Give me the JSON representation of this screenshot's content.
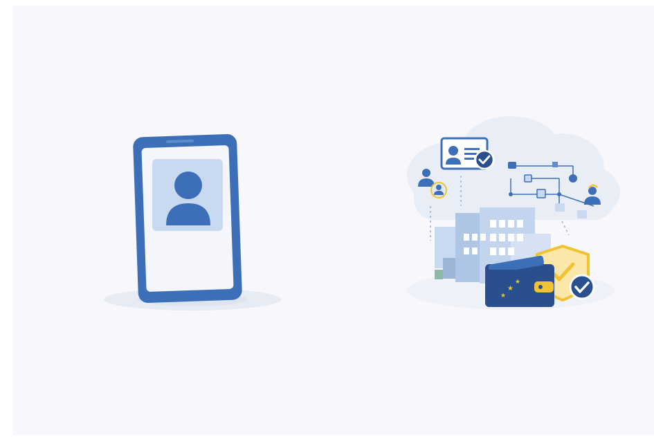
{
  "scene": {
    "left_illustration": "phone-profile",
    "right_illustration": "digital-identity-ecosystem",
    "icons": [
      "user-icon",
      "id-card-icon",
      "checkmark-icon",
      "cloud-icon",
      "building-icon",
      "wallet-icon",
      "shield-icon",
      "network-icon"
    ]
  },
  "colors": {
    "background": "#f8f7fb",
    "primary_blue": "#3d6fb8",
    "dark_blue": "#2a4f8f",
    "light_blue": "#c9d9ef",
    "cloud": "#e9eef6",
    "accent_gold": "#f1c232",
    "white": "#ffffff"
  }
}
